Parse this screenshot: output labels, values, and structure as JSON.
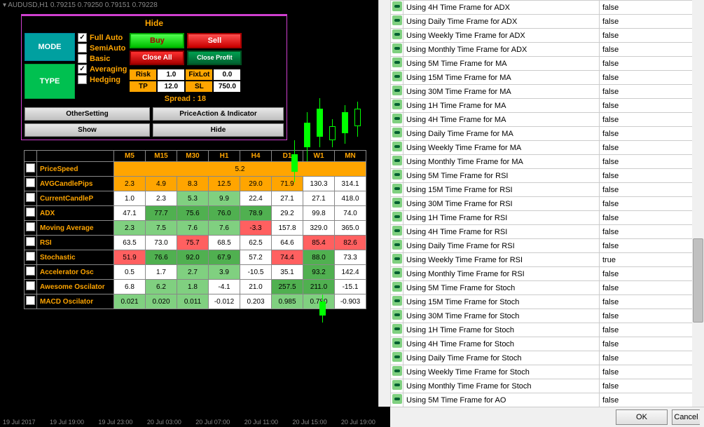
{
  "header": {
    "symbol": "AUDUSD,H1",
    "p1": "0.79215",
    "p2": "0.79250",
    "p3": "0.79151",
    "p4": "0.79228"
  },
  "panel": {
    "hide": "Hide",
    "mode": "MODE",
    "type": "TYPE",
    "checks": {
      "fullauto": "Full Auto",
      "semiauto": "SemiAuto",
      "basic": "Basic",
      "averaging": "Averaging",
      "hedging": "Hedging"
    },
    "buttons": {
      "buy": "Buy",
      "sell": "Sell",
      "closeall": "Close All",
      "closeprofit": "Close Profit"
    },
    "params": {
      "risk_l": "Risk",
      "risk_v": "1.0",
      "fixlot_l": "FixLot",
      "fixlot_v": "0.0",
      "tp_l": "TP",
      "tp_v": "12.0",
      "sl_l": "SL",
      "sl_v": "750.0",
      "spread": "Spread : 18"
    },
    "bars": {
      "other": "OtherSetting",
      "show": "Show",
      "pai": "PriceAction & Indicator",
      "hide2": "Hide"
    }
  },
  "table": {
    "headers": [
      "M5",
      "M15",
      "M30",
      "H1",
      "H4",
      "D1",
      "W1",
      "MN"
    ],
    "rows": [
      {
        "label": "PriceSpeed",
        "span": "5.2"
      },
      {
        "label": "AVGCandlePips",
        "cells": [
          {
            "v": "2.3",
            "c": "orange"
          },
          {
            "v": "4.9",
            "c": "orange"
          },
          {
            "v": "8.3",
            "c": "orange"
          },
          {
            "v": "12.5",
            "c": "orange"
          },
          {
            "v": "29.0",
            "c": "orange"
          },
          {
            "v": "71.9",
            "c": "orange"
          },
          {
            "v": "130.3",
            "c": "white"
          },
          {
            "v": "314.1",
            "c": "white"
          }
        ]
      },
      {
        "label": "CurrentCandleP",
        "cells": [
          {
            "v": "1.0",
            "c": "white"
          },
          {
            "v": "2.3",
            "c": "white"
          },
          {
            "v": "5.3",
            "c": "green"
          },
          {
            "v": "9.9",
            "c": "green"
          },
          {
            "v": "22.4",
            "c": "white"
          },
          {
            "v": "27.1",
            "c": "white"
          },
          {
            "v": "27.1",
            "c": "white"
          },
          {
            "v": "418.0",
            "c": "white"
          }
        ]
      },
      {
        "label": "ADX",
        "cells": [
          {
            "v": "47.1",
            "c": "white"
          },
          {
            "v": "77.7",
            "c": "dgreen"
          },
          {
            "v": "75.6",
            "c": "dgreen"
          },
          {
            "v": "76.0",
            "c": "dgreen"
          },
          {
            "v": "78.9",
            "c": "dgreen"
          },
          {
            "v": "29.2",
            "c": "white"
          },
          {
            "v": "99.8",
            "c": "white"
          },
          {
            "v": "74.0",
            "c": "white"
          }
        ]
      },
      {
        "label": "Moving Average",
        "cells": [
          {
            "v": "2.3",
            "c": "green"
          },
          {
            "v": "7.5",
            "c": "green"
          },
          {
            "v": "7.6",
            "c": "green"
          },
          {
            "v": "7.6",
            "c": "green"
          },
          {
            "v": "-3.3",
            "c": "red"
          },
          {
            "v": "157.8",
            "c": "white"
          },
          {
            "v": "329.0",
            "c": "white"
          },
          {
            "v": "365.0",
            "c": "white"
          }
        ]
      },
      {
        "label": "RSI",
        "cells": [
          {
            "v": "63.5",
            "c": "white"
          },
          {
            "v": "73.0",
            "c": "white"
          },
          {
            "v": "75.7",
            "c": "red"
          },
          {
            "v": "68.5",
            "c": "white"
          },
          {
            "v": "62.5",
            "c": "white"
          },
          {
            "v": "64.6",
            "c": "white"
          },
          {
            "v": "85.4",
            "c": "red"
          },
          {
            "v": "82.6",
            "c": "red"
          }
        ]
      },
      {
        "label": "Stochastic",
        "cells": [
          {
            "v": "51.9",
            "c": "red"
          },
          {
            "v": "76.6",
            "c": "dgreen"
          },
          {
            "v": "92.0",
            "c": "dgreen"
          },
          {
            "v": "67.9",
            "c": "dgreen"
          },
          {
            "v": "57.2",
            "c": "white"
          },
          {
            "v": "74.4",
            "c": "red"
          },
          {
            "v": "88.0",
            "c": "dgreen"
          },
          {
            "v": "73.3",
            "c": "white"
          }
        ]
      },
      {
        "label": "Accelerator Osc",
        "cells": [
          {
            "v": "0.5",
            "c": "white"
          },
          {
            "v": "1.7",
            "c": "white"
          },
          {
            "v": "2.7",
            "c": "green"
          },
          {
            "v": "3.9",
            "c": "green"
          },
          {
            "v": "-10.5",
            "c": "white"
          },
          {
            "v": "35.1",
            "c": "white"
          },
          {
            "v": "93.2",
            "c": "dgreen"
          },
          {
            "v": "142.4",
            "c": "white"
          }
        ]
      },
      {
        "label": "Awesome Oscilator",
        "cells": [
          {
            "v": "6.8",
            "c": "white"
          },
          {
            "v": "6.2",
            "c": "green"
          },
          {
            "v": "1.8",
            "c": "green"
          },
          {
            "v": "-4.1",
            "c": "white"
          },
          {
            "v": "21.0",
            "c": "white"
          },
          {
            "v": "257.5",
            "c": "dgreen"
          },
          {
            "v": "211.0",
            "c": "dgreen"
          },
          {
            "v": "-15.1",
            "c": "white"
          }
        ]
      },
      {
        "label": "MACD Oscilator",
        "cells": [
          {
            "v": "0.021",
            "c": "green"
          },
          {
            "v": "0.020",
            "c": "green"
          },
          {
            "v": "0.011",
            "c": "green"
          },
          {
            "v": "-0.012",
            "c": "white"
          },
          {
            "v": "0.203",
            "c": "white"
          },
          {
            "v": "0.985",
            "c": "green"
          },
          {
            "v": "0.780",
            "c": "green"
          },
          {
            "v": "-0.903",
            "c": "white"
          }
        ]
      }
    ]
  },
  "time_axis": [
    "19 Jul 2017",
    "19 Jul 19:00",
    "19 Jul 23:00",
    "20 Jul 03:00",
    "20 Jul 07:00",
    "20 Jul 11:00",
    "20 Jul 15:00",
    "20 Jul 19:00"
  ],
  "props": [
    {
      "label": "Using 4H Time Frame for ADX",
      "val": "false"
    },
    {
      "label": "Using Daily Time Frame for ADX",
      "val": "false"
    },
    {
      "label": "Using Weekly Time Frame for ADX",
      "val": "false"
    },
    {
      "label": "Using Monthly Time Frame for ADX",
      "val": "false"
    },
    {
      "label": "Using 5M Time Frame for MA",
      "val": "false"
    },
    {
      "label": "Using 15M Time Frame for MA",
      "val": "false"
    },
    {
      "label": "Using 30M Time Frame for MA",
      "val": "false"
    },
    {
      "label": "Using 1H Time Frame for MA",
      "val": "false"
    },
    {
      "label": "Using 4H Time Frame for MA",
      "val": "false"
    },
    {
      "label": "Using Daily Time Frame for MA",
      "val": "false"
    },
    {
      "label": "Using Weekly Time Frame for MA",
      "val": "false"
    },
    {
      "label": "Using Monthly Time Frame for MA",
      "val": "false"
    },
    {
      "label": "Using 5M Time Frame for RSI",
      "val": "false"
    },
    {
      "label": "Using 15M Time Frame for RSI",
      "val": "false"
    },
    {
      "label": "Using 30M Time Frame for RSI",
      "val": "false"
    },
    {
      "label": "Using 1H Time Frame for RSI",
      "val": "false"
    },
    {
      "label": "Using 4H Time Frame for RSI",
      "val": "false"
    },
    {
      "label": "Using Daily Time Frame for RSI",
      "val": "false"
    },
    {
      "label": "Using Weekly Time Frame for RSI",
      "val": "true"
    },
    {
      "label": "Using Monthly Time Frame for RSI",
      "val": "false"
    },
    {
      "label": "Using 5M Time Frame for Stoch",
      "val": "false"
    },
    {
      "label": "Using 15M Time Frame for Stoch",
      "val": "false"
    },
    {
      "label": "Using 30M Time Frame for Stoch",
      "val": "false"
    },
    {
      "label": "Using 1H Time Frame for Stoch",
      "val": "false"
    },
    {
      "label": "Using 4H Time Frame for Stoch",
      "val": "false"
    },
    {
      "label": "Using Daily Time Frame for Stoch",
      "val": "false"
    },
    {
      "label": "Using Weekly Time Frame for Stoch",
      "val": "false"
    },
    {
      "label": "Using Monthly Time Frame for Stoch",
      "val": "false"
    },
    {
      "label": "Using 5M Time Frame for AO",
      "val": "false"
    }
  ],
  "bottom": {
    "ok": "OK",
    "cancel": "Cancel"
  }
}
